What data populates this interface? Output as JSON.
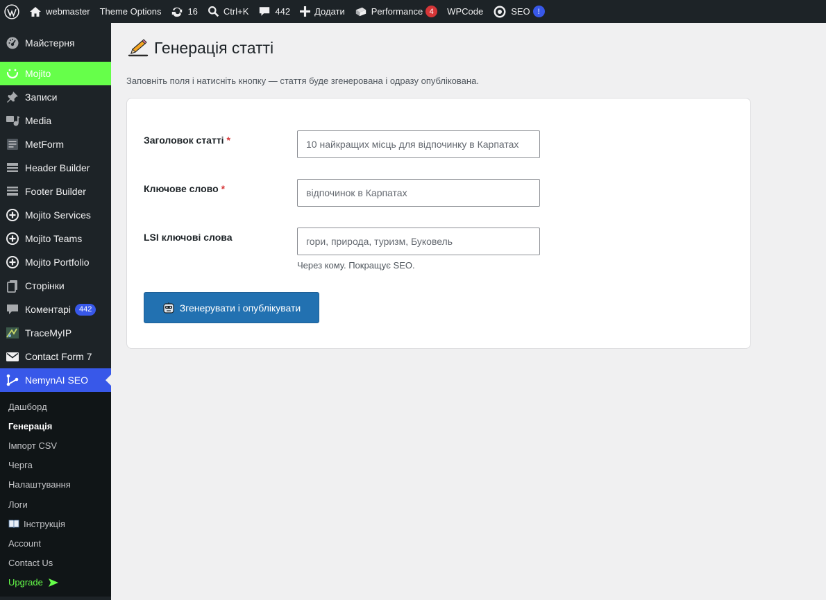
{
  "admin_bar": {
    "site_name": "webmaster",
    "theme_options": "Theme Options",
    "updates_count": "16",
    "search_shortcut": "Ctrl+K",
    "comments_count": "442",
    "add_new": "Додати",
    "performance": "Performance",
    "performance_badge": "4",
    "wpcode": "WPCode",
    "seo": "SEO",
    "seo_badge": "!"
  },
  "sidebar": {
    "items": [
      {
        "label": "Майстерня",
        "icon": "dashboard-icon"
      },
      {
        "label": "Mojito",
        "icon": "smile-icon"
      },
      {
        "label": "Записи",
        "icon": "pin-icon"
      },
      {
        "label": "Media",
        "icon": "media-icon"
      },
      {
        "label": "MetForm",
        "icon": "form-icon"
      },
      {
        "label": "Header Builder",
        "icon": "layout-icon"
      },
      {
        "label": "Footer Builder",
        "icon": "layout-icon"
      },
      {
        "label": "Mojito Services",
        "icon": "plus-circle-icon"
      },
      {
        "label": "Mojito Teams",
        "icon": "plus-circle-icon"
      },
      {
        "label": "Mojito Portfolio",
        "icon": "plus-circle-icon"
      },
      {
        "label": "Сторінки",
        "icon": "pages-icon"
      },
      {
        "label": "Коментарі",
        "icon": "comment-icon",
        "count": "442"
      },
      {
        "label": "TraceMyIP",
        "icon": "tracemyip-icon"
      },
      {
        "label": "Contact Form 7",
        "icon": "mail-icon"
      },
      {
        "label": "NemynAI SEO",
        "icon": "nemyn-icon"
      }
    ],
    "submenu": [
      {
        "label": "Дашборд"
      },
      {
        "label": "Генерація"
      },
      {
        "label": "Імпорт CSV"
      },
      {
        "label": "Черга"
      },
      {
        "label": "Налаштування"
      },
      {
        "label": "Логи"
      },
      {
        "label": "Інструкція",
        "icon": "book-icon"
      },
      {
        "label": "Account"
      },
      {
        "label": "Contact Us"
      },
      {
        "label": "Upgrade",
        "icon": "arrow-right-icon"
      }
    ]
  },
  "page": {
    "title": "Генерація статті",
    "intro": "Заповніть поля і натисніть кнопку — стаття буде згенерована і одразу опублікована."
  },
  "form": {
    "title_label": "Заголовок статті",
    "title_placeholder": "10 найкращих місць для відпочинку в Карпатах",
    "keyword_label": "Ключове слово",
    "keyword_placeholder": "відпочинок в Карпатах",
    "lsi_label": "LSI ключові слова",
    "lsi_placeholder": "гори, природа, туризм, Буковель",
    "lsi_hint": "Через кому. Покращує SEO.",
    "required_mark": "*",
    "submit_label": "Згенерувати і опублікувати"
  },
  "colors": {
    "admin_bg": "#1d2327",
    "mojito_accent": "#66ff4a",
    "current_menu": "#3858e9",
    "primary_button": "#2271b1",
    "required": "#d63638"
  }
}
